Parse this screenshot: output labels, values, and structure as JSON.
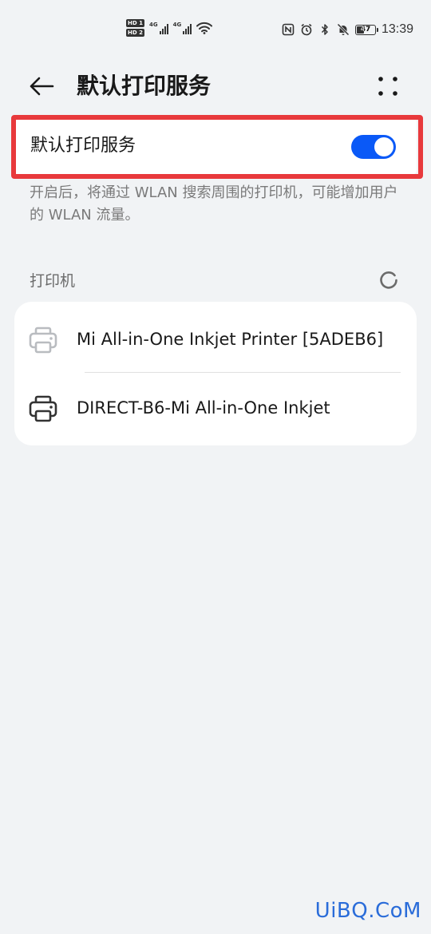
{
  "status_bar": {
    "sim1": "HD 1",
    "sim2": "HD 2",
    "network1": "4G",
    "network2": "4G",
    "battery_level": 47,
    "battery_text": "47",
    "time": "13:39",
    "icons": [
      "nfc-icon",
      "alarm-icon",
      "bluetooth-icon",
      "mute-icon"
    ]
  },
  "header": {
    "back_icon": "arrow-left-icon",
    "title": "默认打印服务",
    "more_icon": "more-dots-icon"
  },
  "service_toggle": {
    "label": "默认打印服务",
    "enabled": true,
    "accent_color": "#0a59f7",
    "highlight_color": "#e8393c"
  },
  "description": "开启后，将通过 WLAN 搜索周围的打印机，可能增加用户的 WLAN 流量。",
  "printers_section": {
    "title": "打印机",
    "status_icon": "loading-spinner-icon",
    "items": [
      {
        "name": "Mi All-in-One Inkjet Printer [5ADEB6]",
        "icon": "printer-icon",
        "available": false
      },
      {
        "name": "DIRECT-B6-Mi All-in-One Inkjet",
        "icon": "printer-icon",
        "available": true
      }
    ]
  },
  "watermark": "UiBQ.CoM"
}
